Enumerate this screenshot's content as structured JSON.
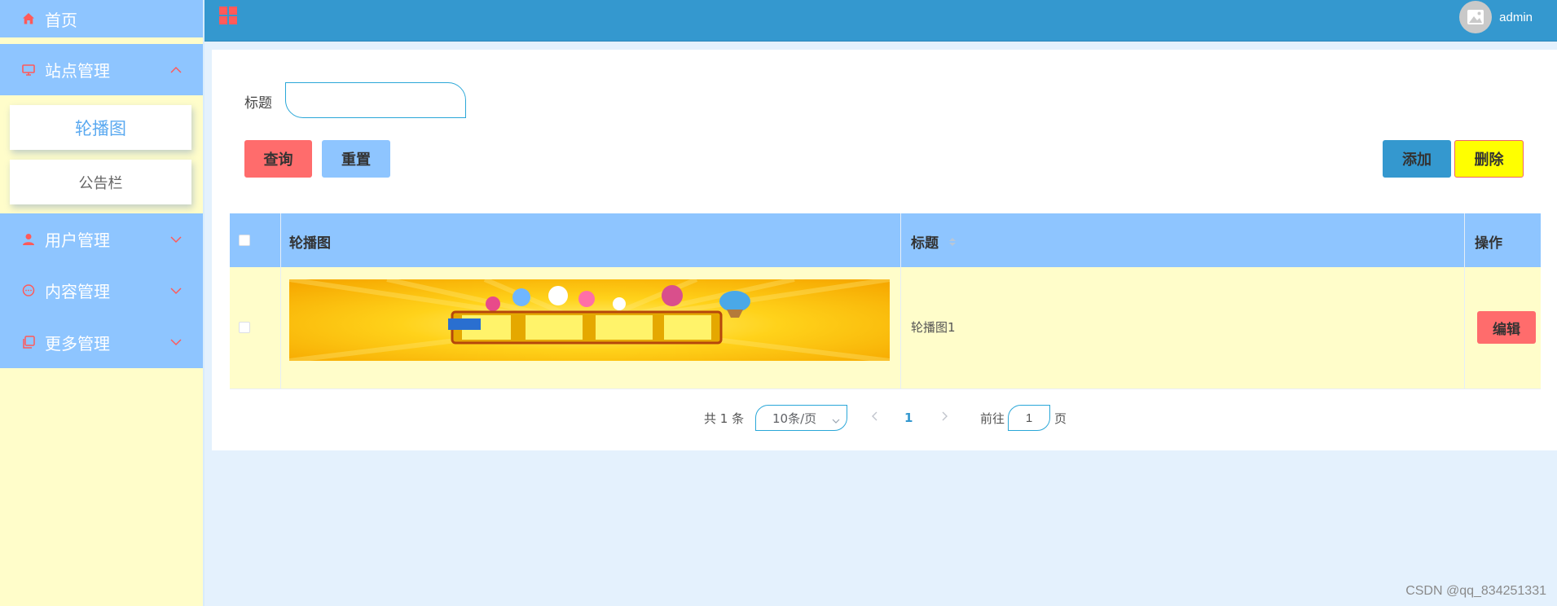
{
  "sidebar": {
    "items": [
      {
        "label": "首页",
        "icon": "home-icon"
      },
      {
        "label": "站点管理",
        "icon": "monitor-icon",
        "expanded": true
      },
      {
        "label": "用户管理",
        "icon": "user-icon"
      },
      {
        "label": "内容管理",
        "icon": "chat-icon"
      },
      {
        "label": "更多管理",
        "icon": "copy-icon"
      }
    ],
    "subitems": [
      {
        "label": "轮播图",
        "active": true
      },
      {
        "label": "公告栏"
      }
    ]
  },
  "header": {
    "username": "admin"
  },
  "search": {
    "label": "标题",
    "value": "",
    "placeholder": ""
  },
  "toolbar": {
    "query_label": "查询",
    "reset_label": "重置",
    "add_label": "添加",
    "delete_label": "删除"
  },
  "table": {
    "headers": [
      "轮播图",
      "标题",
      "操作"
    ],
    "rows": [
      {
        "image": "banner-image",
        "title": "轮播图1",
        "action": "编辑"
      }
    ]
  },
  "pagination": {
    "total_text": "共 1 条",
    "page_size": "10条/页",
    "current_page": "1",
    "goto_prefix": "前往",
    "goto_value": "1",
    "goto_suffix": "页"
  },
  "watermark": "CSDN @qq_834251331",
  "colors": {
    "menu_bg": "#8ec5ff",
    "sidebar_bg": "#fffdca",
    "header_bg": "#3498cf",
    "accent_red": "#ff6c6c",
    "delete_yellow": "#ffff00",
    "page_bg": "#e4f1fd"
  }
}
